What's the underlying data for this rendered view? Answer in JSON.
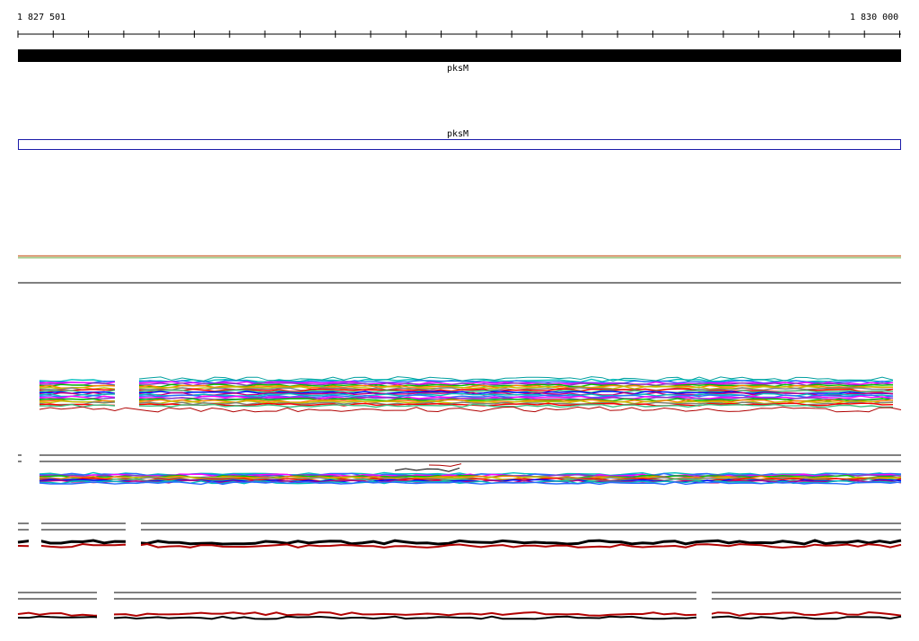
{
  "ruler": {
    "start_label": "1 827 501",
    "end_label": "1 830 000"
  },
  "genes": [
    {
      "name": "pksM",
      "style": "solid-bar",
      "color": "#000000"
    },
    {
      "name": "pksM",
      "style": "outline-box",
      "color": "#1a1aa8"
    }
  ],
  "track_colors": [
    "#00bfbf",
    "#2b6bff",
    "#ff00ff",
    "#7f3fbf",
    "#00c000",
    "#ff7f00",
    "#c0c000",
    "#7f7f7f",
    "#ff0000",
    "#3fbf7f",
    "#0000ff",
    "#bf007f"
  ]
}
